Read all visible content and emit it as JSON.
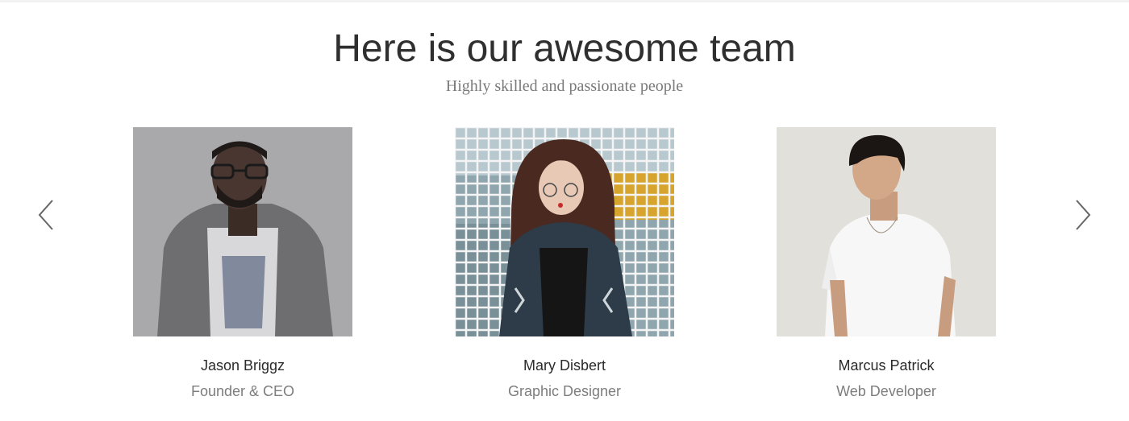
{
  "team_section": {
    "title": "Here is our awesome team",
    "subtitle": "Highly skilled and passionate people"
  },
  "carousel": {
    "prev_icon": "chevron-left-icon",
    "next_icon": "chevron-right-icon",
    "members": [
      {
        "name": "Jason Briggz",
        "role": "Founder & CEO"
      },
      {
        "name": "Mary Disbert",
        "role": "Graphic Designer"
      },
      {
        "name": "Marcus Patrick",
        "role": "Web Developer"
      }
    ]
  },
  "colors": {
    "title": "#2f2f2f",
    "subtitle": "#7a7a7a",
    "name": "#2a2a2a",
    "role": "#7d7d7d",
    "arrow": "#666666"
  }
}
